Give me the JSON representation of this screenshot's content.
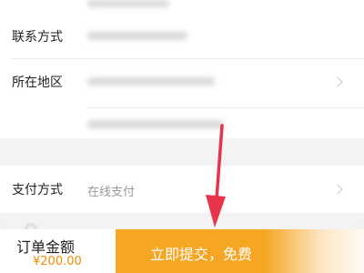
{
  "form": {
    "contact_label": "联系方式",
    "region_label": "所在地区",
    "payment_label": "支付方式",
    "payment_value": "在线支付"
  },
  "bottom": {
    "order_amount_label": "订单金额",
    "order_amount_value": "¥200.00",
    "submit_label": "立即提交，免费"
  },
  "colors": {
    "accent": "#f5a623",
    "price": "#f08c00",
    "annotation_arrow": "#e8334a"
  },
  "icons": [
    "chevron-right-icon",
    "annotation-arrow-icon"
  ]
}
